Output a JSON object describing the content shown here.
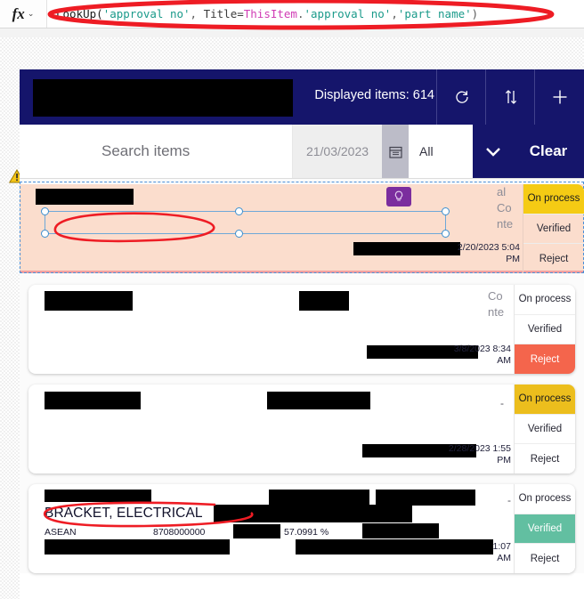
{
  "formula_bar": {
    "fx_label": "fx",
    "chevron": "⌄",
    "expression_parts": [
      {
        "text": "LookUp(",
        "type": "fn"
      },
      {
        "text": "'approval no'",
        "type": "str"
      },
      {
        "text": ", ",
        "type": "punct"
      },
      {
        "text": "Title=",
        "type": "id"
      },
      {
        "text": "ThisItem",
        "type": "this"
      },
      {
        "text": ".",
        "type": "punct"
      },
      {
        "text": "'approval no'",
        "type": "str"
      },
      {
        "text": ",",
        "type": "punct"
      },
      {
        "text": "'part name'",
        "type": "str"
      },
      {
        "text": ")",
        "type": "punct"
      }
    ],
    "expression_plain": "LookUp('approval no', Title=ThisItem.'approval no','part name')"
  },
  "warning": {
    "icon": "warning-triangle-icon",
    "chevron": "⌄"
  },
  "app_header": {
    "title_redacted": true,
    "displayed_items": "Displayed items: 614",
    "buttons": [
      {
        "name": "refresh-button",
        "icon": "refresh-icon"
      },
      {
        "name": "sort-button",
        "icon": "sort-icon"
      },
      {
        "name": "add-button",
        "icon": "plus-icon"
      }
    ]
  },
  "search_row": {
    "search_placeholder": "Search items",
    "search_value": "",
    "date_value": "21/03/2023",
    "calendar_icon": "calendar-icon",
    "filter_value": "All",
    "dropdown_icon": "chevron-down-icon",
    "clear_label": "Clear"
  },
  "colors": {
    "header_navy": "#15156b",
    "on_process": "#ecbe1d",
    "reject": "#f4654c",
    "verified": "#62bfa1",
    "selected_card": "#fbddcd",
    "annotation_red": "#ee1c24",
    "purple_badge": "#7b2d9e"
  },
  "status_labels": {
    "on_process": "On process",
    "verified": "Verified",
    "reject": "Reject"
  },
  "cards": [
    {
      "selected": true,
      "truncated_text": "al Co nte",
      "date": "2/20/2023 5:04 PM",
      "active_status": "on_process",
      "badge_icon": "lightbulb-icon",
      "title_redacted": true,
      "annotated": true
    },
    {
      "selected": false,
      "truncated_text": "Co nte",
      "date": "3/8/2023 8:34 AM",
      "active_status": "reject",
      "title_redacted": true,
      "annotated": false
    },
    {
      "selected": false,
      "truncated_text": "",
      "dash": "-",
      "date": "2/28/2023 1:55 PM",
      "active_status": "on_process",
      "title_redacted": true,
      "annotated": false
    },
    {
      "selected": false,
      "truncated_text": "",
      "dash": "-",
      "part_name": "BRACKET, ELECTRICAL",
      "region": "ASEAN",
      "hs_code": "8708000000",
      "percentage": "57.0991 %",
      "date": "1/11/2023 11:07 AM",
      "active_status": "verified",
      "title_redacted": true,
      "annotated": true
    }
  ]
}
